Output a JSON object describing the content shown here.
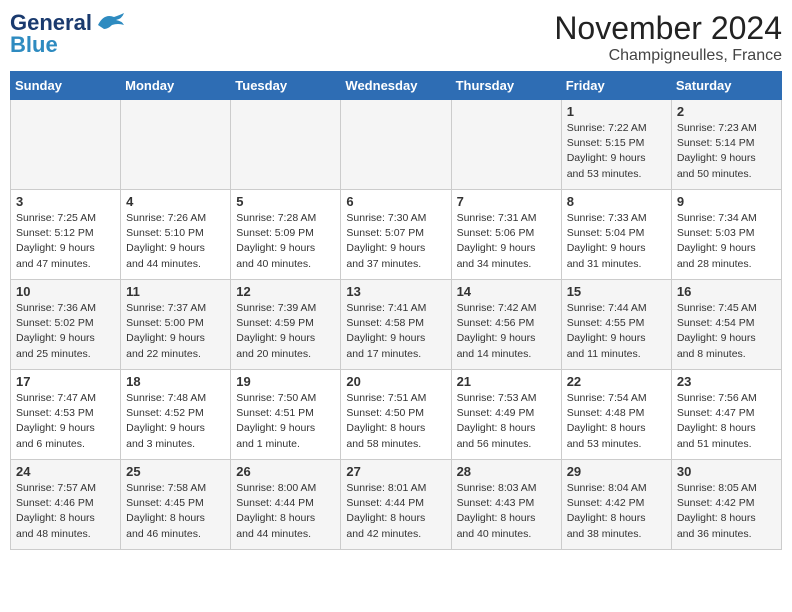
{
  "header": {
    "logo_line1": "General",
    "logo_line2": "Blue",
    "month": "November 2024",
    "location": "Champigneulles, France"
  },
  "days_of_week": [
    "Sunday",
    "Monday",
    "Tuesday",
    "Wednesday",
    "Thursday",
    "Friday",
    "Saturday"
  ],
  "weeks": [
    [
      {
        "day": "",
        "info": ""
      },
      {
        "day": "",
        "info": ""
      },
      {
        "day": "",
        "info": ""
      },
      {
        "day": "",
        "info": ""
      },
      {
        "day": "",
        "info": ""
      },
      {
        "day": "1",
        "info": "Sunrise: 7:22 AM\nSunset: 5:15 PM\nDaylight: 9 hours and 53 minutes."
      },
      {
        "day": "2",
        "info": "Sunrise: 7:23 AM\nSunset: 5:14 PM\nDaylight: 9 hours and 50 minutes."
      }
    ],
    [
      {
        "day": "3",
        "info": "Sunrise: 7:25 AM\nSunset: 5:12 PM\nDaylight: 9 hours and 47 minutes."
      },
      {
        "day": "4",
        "info": "Sunrise: 7:26 AM\nSunset: 5:10 PM\nDaylight: 9 hours and 44 minutes."
      },
      {
        "day": "5",
        "info": "Sunrise: 7:28 AM\nSunset: 5:09 PM\nDaylight: 9 hours and 40 minutes."
      },
      {
        "day": "6",
        "info": "Sunrise: 7:30 AM\nSunset: 5:07 PM\nDaylight: 9 hours and 37 minutes."
      },
      {
        "day": "7",
        "info": "Sunrise: 7:31 AM\nSunset: 5:06 PM\nDaylight: 9 hours and 34 minutes."
      },
      {
        "day": "8",
        "info": "Sunrise: 7:33 AM\nSunset: 5:04 PM\nDaylight: 9 hours and 31 minutes."
      },
      {
        "day": "9",
        "info": "Sunrise: 7:34 AM\nSunset: 5:03 PM\nDaylight: 9 hours and 28 minutes."
      }
    ],
    [
      {
        "day": "10",
        "info": "Sunrise: 7:36 AM\nSunset: 5:02 PM\nDaylight: 9 hours and 25 minutes."
      },
      {
        "day": "11",
        "info": "Sunrise: 7:37 AM\nSunset: 5:00 PM\nDaylight: 9 hours and 22 minutes."
      },
      {
        "day": "12",
        "info": "Sunrise: 7:39 AM\nSunset: 4:59 PM\nDaylight: 9 hours and 20 minutes."
      },
      {
        "day": "13",
        "info": "Sunrise: 7:41 AM\nSunset: 4:58 PM\nDaylight: 9 hours and 17 minutes."
      },
      {
        "day": "14",
        "info": "Sunrise: 7:42 AM\nSunset: 4:56 PM\nDaylight: 9 hours and 14 minutes."
      },
      {
        "day": "15",
        "info": "Sunrise: 7:44 AM\nSunset: 4:55 PM\nDaylight: 9 hours and 11 minutes."
      },
      {
        "day": "16",
        "info": "Sunrise: 7:45 AM\nSunset: 4:54 PM\nDaylight: 9 hours and 8 minutes."
      }
    ],
    [
      {
        "day": "17",
        "info": "Sunrise: 7:47 AM\nSunset: 4:53 PM\nDaylight: 9 hours and 6 minutes."
      },
      {
        "day": "18",
        "info": "Sunrise: 7:48 AM\nSunset: 4:52 PM\nDaylight: 9 hours and 3 minutes."
      },
      {
        "day": "19",
        "info": "Sunrise: 7:50 AM\nSunset: 4:51 PM\nDaylight: 9 hours and 1 minute."
      },
      {
        "day": "20",
        "info": "Sunrise: 7:51 AM\nSunset: 4:50 PM\nDaylight: 8 hours and 58 minutes."
      },
      {
        "day": "21",
        "info": "Sunrise: 7:53 AM\nSunset: 4:49 PM\nDaylight: 8 hours and 56 minutes."
      },
      {
        "day": "22",
        "info": "Sunrise: 7:54 AM\nSunset: 4:48 PM\nDaylight: 8 hours and 53 minutes."
      },
      {
        "day": "23",
        "info": "Sunrise: 7:56 AM\nSunset: 4:47 PM\nDaylight: 8 hours and 51 minutes."
      }
    ],
    [
      {
        "day": "24",
        "info": "Sunrise: 7:57 AM\nSunset: 4:46 PM\nDaylight: 8 hours and 48 minutes."
      },
      {
        "day": "25",
        "info": "Sunrise: 7:58 AM\nSunset: 4:45 PM\nDaylight: 8 hours and 46 minutes."
      },
      {
        "day": "26",
        "info": "Sunrise: 8:00 AM\nSunset: 4:44 PM\nDaylight: 8 hours and 44 minutes."
      },
      {
        "day": "27",
        "info": "Sunrise: 8:01 AM\nSunset: 4:44 PM\nDaylight: 8 hours and 42 minutes."
      },
      {
        "day": "28",
        "info": "Sunrise: 8:03 AM\nSunset: 4:43 PM\nDaylight: 8 hours and 40 minutes."
      },
      {
        "day": "29",
        "info": "Sunrise: 8:04 AM\nSunset: 4:42 PM\nDaylight: 8 hours and 38 minutes."
      },
      {
        "day": "30",
        "info": "Sunrise: 8:05 AM\nSunset: 4:42 PM\nDaylight: 8 hours and 36 minutes."
      }
    ]
  ]
}
